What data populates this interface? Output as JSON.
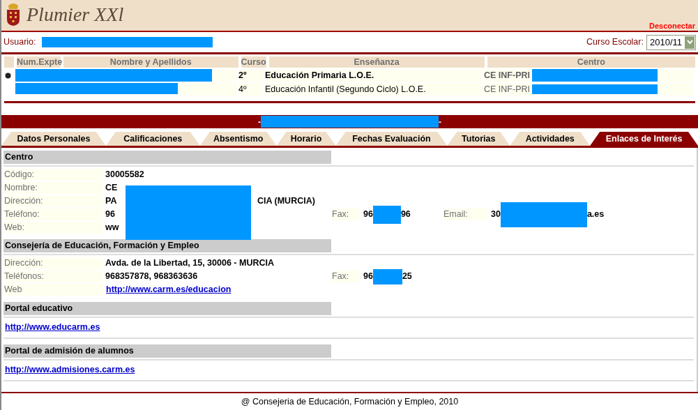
{
  "header": {
    "logo_text": "Plumier XXl",
    "logout": "Desconectar"
  },
  "user_bar": {
    "user_label": "Usuario:",
    "year_label": "Curso Escolar:",
    "year_value": "2010/11"
  },
  "students": {
    "columns": [
      "Num.Expte",
      "Nombre y Apellidos",
      "Curso",
      "Enseñanza",
      "Centro"
    ],
    "rows": [
      {
        "selected": true,
        "curso": "2º",
        "ensenanza": "Educación Primaria L.O.E.",
        "centro": "CE INF-PRI"
      },
      {
        "selected": false,
        "curso": "4º",
        "ensenanza": "Educación Infantil (Segundo Ciclo) L.O.E.",
        "centro": "CE INF-PRI"
      }
    ]
  },
  "banner": {
    "left": "-",
    "right": "-"
  },
  "tabs": [
    {
      "label": "Datos Personales",
      "selected": false
    },
    {
      "label": "Calificaciones",
      "selected": false
    },
    {
      "label": "Absentismo",
      "selected": false
    },
    {
      "label": "Horario",
      "selected": false
    },
    {
      "label": "Fechas Evaluación",
      "selected": false
    },
    {
      "label": "Tutorias",
      "selected": false
    },
    {
      "label": "Actividades",
      "selected": false
    },
    {
      "label": "Enlaces de Interés",
      "selected": true
    }
  ],
  "sections": [
    {
      "title": "Centro",
      "kind": "fields",
      "rows": [
        {
          "label": "Código:",
          "parts": [
            "30005582"
          ]
        },
        {
          "label": "Nombre:",
          "parts": [
            "CE"
          ]
        },
        {
          "label": "Dirección:",
          "parts": [
            "PA",
            "CIA (MURCIA)"
          ]
        },
        {
          "label": "Teléfono:",
          "parts": [
            "96"
          ],
          "extra": [
            {
              "label": "Fax:",
              "parts": [
                "96",
                "96"
              ]
            },
            {
              "label": "Email:",
              "parts": [
                "30",
                "a.es"
              ]
            }
          ]
        },
        {
          "label": "Web:",
          "parts": [
            "ww"
          ]
        }
      ]
    },
    {
      "title": "Consejería de Educación, Formación y Empleo",
      "kind": "fields",
      "rows": [
        {
          "label": "Dirección:",
          "parts": [
            "Avda. de la Libertad, 15, 30006 - MURCIA"
          ]
        },
        {
          "label": "Teléfonos:",
          "parts": [
            "968357878, 968363636"
          ],
          "extra": [
            {
              "label": "Fax:",
              "parts": [
                "96",
                "25"
              ]
            }
          ]
        },
        {
          "label": "Web",
          "link": "http://www.carm.es/educacion"
        }
      ]
    },
    {
      "title": "Portal educativo",
      "kind": "link",
      "link": "http://www.educarm.es"
    },
    {
      "title": "Portal de admisión de alumnos",
      "kind": "link",
      "link": "http://www.admisiones.carm.es"
    }
  ],
  "footer": "@ Consejeria de Educación, Formación y Empleo, 2010"
}
